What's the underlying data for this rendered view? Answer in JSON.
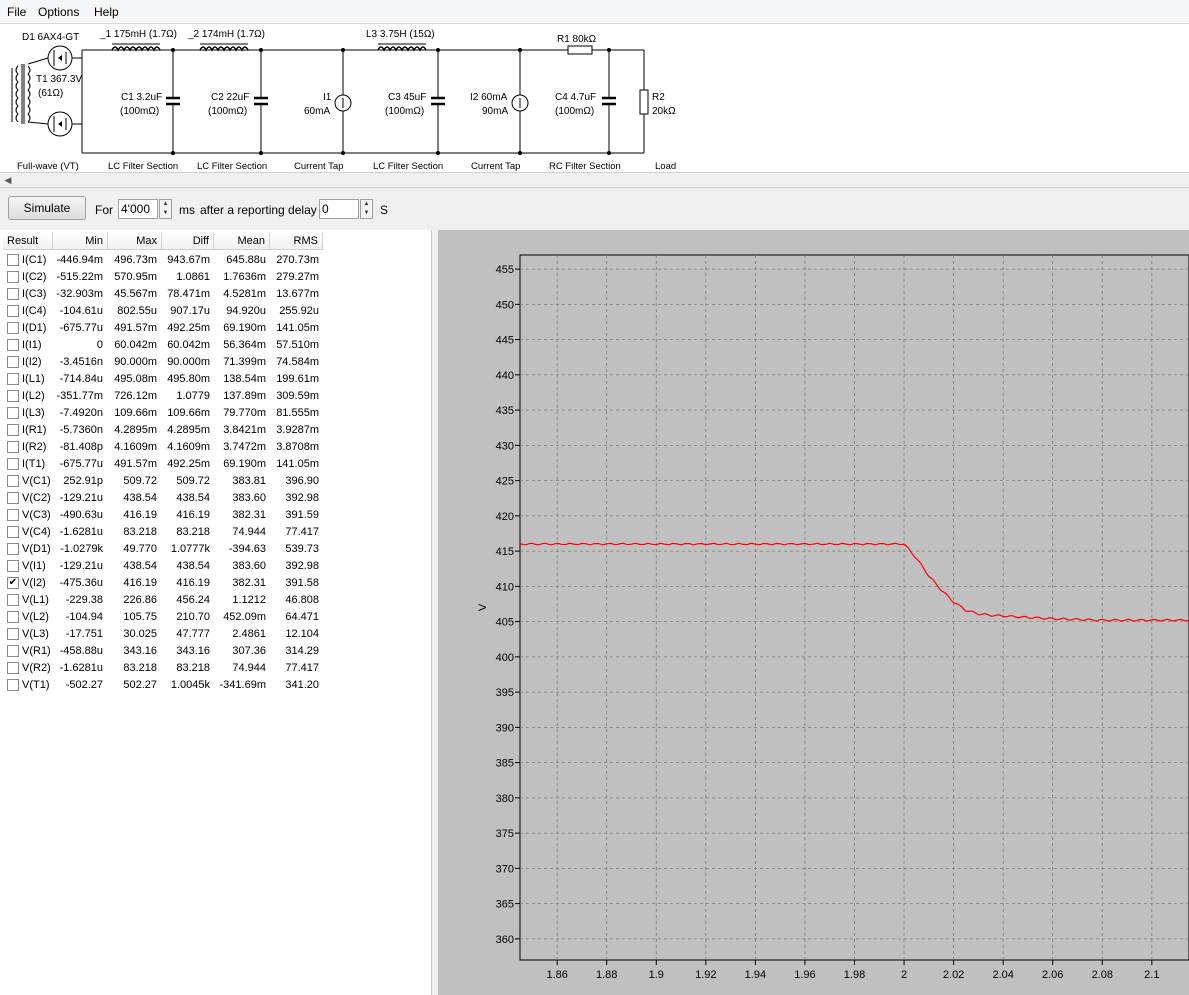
{
  "menu": [
    "File",
    "Options",
    "Help"
  ],
  "schematic": {
    "labels": {
      "d1": "D1 6AX4-GT",
      "t1_name": "T1 367.3V",
      "t1_res": "(61Ω)",
      "l1": "_1 175mH (1.7Ω)",
      "l2": "_2 174mH (1.7Ω)",
      "l3": "L3 3.75H (15Ω)",
      "r1": "R1 80kΩ",
      "c1_val": "C1 3.2uF",
      "c1_esr": "(100mΩ)",
      "c2_val": "C2 22uF",
      "c2_esr": "(100mΩ)",
      "i1_name": "I1",
      "i1_val": "60mA",
      "c3_val": "C3 45uF",
      "c3_esr": "(100mΩ)",
      "i2_name": "I2 60mA",
      "i2_val": "90mA",
      "c4_val": "C4 4.7uF",
      "c4_esr": "(100mΩ)",
      "r2_name": "R2",
      "r2_val": "20kΩ"
    },
    "sections": [
      "Full-wave (VT)",
      "LC Filter Section",
      "LC Filter Section",
      "Current Tap",
      "LC Filter Section",
      "Current Tap",
      "RC Filter Section",
      "Load"
    ]
  },
  "toolbar": {
    "simulate_label": "Simulate",
    "for_label": "For",
    "duration_value": "4'000",
    "ms_label": "ms",
    "delay_label": "after a reporting delay of",
    "delay_value": "0",
    "s_label": "S"
  },
  "results": {
    "headers": [
      "Result",
      "Min",
      "Max",
      "Diff",
      "Mean",
      "RMS"
    ],
    "rows": [
      {
        "name": "I(C1)",
        "min": "-446.94m",
        "max": "496.73m",
        "diff": "943.67m",
        "mean": "645.88u",
        "rms": "270.73m",
        "checked": false
      },
      {
        "name": "I(C2)",
        "min": "-515.22m",
        "max": "570.95m",
        "diff": "1.0861",
        "mean": "1.7636m",
        "rms": "279.27m",
        "checked": false
      },
      {
        "name": "I(C3)",
        "min": "-32.903m",
        "max": "45.567m",
        "diff": "78.471m",
        "mean": "4.5281m",
        "rms": "13.677m",
        "checked": false
      },
      {
        "name": "I(C4)",
        "min": "-104.61u",
        "max": "802.55u",
        "diff": "907.17u",
        "mean": "94.920u",
        "rms": "255.92u",
        "checked": false
      },
      {
        "name": "I(D1)",
        "min": "-675.77u",
        "max": "491.57m",
        "diff": "492.25m",
        "mean": "69.190m",
        "rms": "141.05m",
        "checked": false
      },
      {
        "name": "I(I1)",
        "min": "0",
        "max": "60.042m",
        "diff": "60.042m",
        "mean": "56.364m",
        "rms": "57.510m",
        "checked": false
      },
      {
        "name": "I(I2)",
        "min": "-3.4516n",
        "max": "90.000m",
        "diff": "90.000m",
        "mean": "71.399m",
        "rms": "74.584m",
        "checked": false
      },
      {
        "name": "I(L1)",
        "min": "-714.84u",
        "max": "495.08m",
        "diff": "495.80m",
        "mean": "138.54m",
        "rms": "199.61m",
        "checked": false
      },
      {
        "name": "I(L2)",
        "min": "-351.77m",
        "max": "726.12m",
        "diff": "1.0779",
        "mean": "137.89m",
        "rms": "309.59m",
        "checked": false
      },
      {
        "name": "I(L3)",
        "min": "-7.4920n",
        "max": "109.66m",
        "diff": "109.66m",
        "mean": "79.770m",
        "rms": "81.555m",
        "checked": false
      },
      {
        "name": "I(R1)",
        "min": "-5.7360n",
        "max": "4.2895m",
        "diff": "4.2895m",
        "mean": "3.8421m",
        "rms": "3.9287m",
        "checked": false
      },
      {
        "name": "I(R2)",
        "min": "-81.408p",
        "max": "4.1609m",
        "diff": "4.1609m",
        "mean": "3.7472m",
        "rms": "3.8708m",
        "checked": false
      },
      {
        "name": "I(T1)",
        "min": "-675.77u",
        "max": "491.57m",
        "diff": "492.25m",
        "mean": "69.190m",
        "rms": "141.05m",
        "checked": false
      },
      {
        "name": "V(C1)",
        "min": "252.91p",
        "max": "509.72",
        "diff": "509.72",
        "mean": "383.81",
        "rms": "396.90",
        "checked": false
      },
      {
        "name": "V(C2)",
        "min": "-129.21u",
        "max": "438.54",
        "diff": "438.54",
        "mean": "383.60",
        "rms": "392.98",
        "checked": false
      },
      {
        "name": "V(C3)",
        "min": "-490.63u",
        "max": "416.19",
        "diff": "416.19",
        "mean": "382.31",
        "rms": "391.59",
        "checked": false
      },
      {
        "name": "V(C4)",
        "min": "-1.6281u",
        "max": "83.218",
        "diff": "83.218",
        "mean": "74.944",
        "rms": "77.417",
        "checked": false
      },
      {
        "name": "V(D1)",
        "min": "-1.0279k",
        "max": "49.770",
        "diff": "1.0777k",
        "mean": "-394.63",
        "rms": "539.73",
        "checked": false
      },
      {
        "name": "V(I1)",
        "min": "-129.21u",
        "max": "438.54",
        "diff": "438.54",
        "mean": "383.60",
        "rms": "392.98",
        "checked": false
      },
      {
        "name": "V(I2)",
        "min": "-475.36u",
        "max": "416.19",
        "diff": "416.19",
        "mean": "382.31",
        "rms": "391.58",
        "checked": true
      },
      {
        "name": "V(L1)",
        "min": "-229.38",
        "max": "226.86",
        "diff": "456.24",
        "mean": "1.1212",
        "rms": "46.808",
        "checked": false
      },
      {
        "name": "V(L2)",
        "min": "-104.94",
        "max": "105.75",
        "diff": "210.70",
        "mean": "452.09m",
        "rms": "64.471",
        "checked": false
      },
      {
        "name": "V(L3)",
        "min": "-17.751",
        "max": "30.025",
        "diff": "47.777",
        "mean": "2.4861",
        "rms": "12.104",
        "checked": false
      },
      {
        "name": "V(R1)",
        "min": "-458.88u",
        "max": "343.16",
        "diff": "343.16",
        "mean": "307.36",
        "rms": "314.29",
        "checked": false
      },
      {
        "name": "V(R2)",
        "min": "-1.6281u",
        "max": "83.218",
        "diff": "83.218",
        "mean": "74.944",
        "rms": "77.417",
        "checked": false
      },
      {
        "name": "V(T1)",
        "min": "-502.27",
        "max": "502.27",
        "diff": "1.0045k",
        "mean": "-341.69m",
        "rms": "341.20",
        "checked": false
      }
    ]
  },
  "chart_data": {
    "type": "line",
    "ylabel": "V",
    "xlabel": "",
    "xlim": [
      1.845,
      2.115
    ],
    "ylim": [
      357,
      457
    ],
    "x_ticks": [
      "1.86",
      "1.88",
      "1.9",
      "1.92",
      "1.94",
      "1.96",
      "1.98",
      "2",
      "2.02",
      "2.04",
      "2.06",
      "2.08",
      "2.1"
    ],
    "y_ticks": [
      "455",
      "450",
      "445",
      "440",
      "435",
      "430",
      "425",
      "420",
      "415",
      "410",
      "405",
      "400",
      "395",
      "390",
      "385",
      "380",
      "375",
      "370",
      "365",
      "360"
    ],
    "grid": true,
    "series": [
      {
        "color": "#ff0000",
        "x": [
          1.845,
          1.86,
          1.88,
          1.9,
          1.92,
          1.94,
          1.96,
          1.98,
          2.0,
          2.005,
          2.01,
          2.015,
          2.02,
          2.025,
          2.03,
          2.035,
          2.04,
          2.05,
          2.06,
          2.07,
          2.08,
          2.09,
          2.1,
          2.115
        ],
        "y": [
          416.0,
          416.0,
          416.0,
          416.0,
          416.0,
          416.0,
          416.0,
          416.0,
          416.0,
          414.0,
          411.5,
          409.5,
          407.8,
          406.6,
          406.1,
          405.9,
          405.8,
          405.6,
          405.4,
          405.3,
          405.2,
          405.2,
          405.2,
          405.2
        ]
      }
    ]
  }
}
